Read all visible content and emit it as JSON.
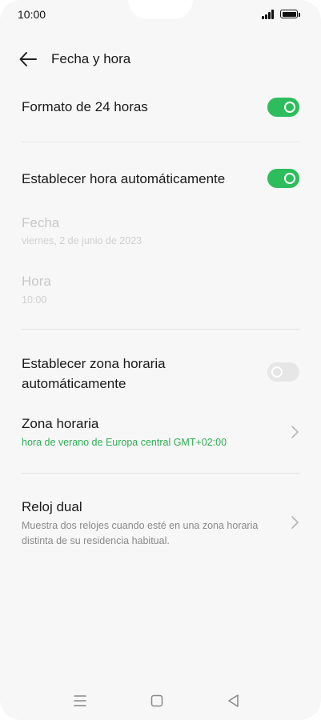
{
  "status_bar": {
    "time": "10:00"
  },
  "header": {
    "title": "Fecha y hora"
  },
  "settings": {
    "format_24h": {
      "label": "Formato de 24 horas",
      "enabled": true
    },
    "auto_time": {
      "label": "Establecer hora automáticamente",
      "enabled": true
    },
    "date": {
      "label": "Fecha",
      "value": "viernes, 2 de junio de 2023"
    },
    "time": {
      "label": "Hora",
      "value": "10:00"
    },
    "auto_timezone": {
      "label_line1": "Establecer zona horaria",
      "label_line2": "automáticamente",
      "enabled": false
    },
    "timezone": {
      "label": "Zona horaria",
      "value": "hora de verano de Europa central GMT+02:00"
    },
    "dual_clock": {
      "label": "Reloj dual",
      "desc_line1": "Muestra dos relojes cuando esté en una zona horaria",
      "desc_line2": "distinta de su residencia habitual."
    }
  },
  "colors": {
    "accent_green": "#2dbd5c",
    "subtitle_green": "#2dad53"
  },
  "icons": [
    "back-arrow-icon",
    "chevron-right-icon",
    "signal-icon",
    "battery-icon",
    "menu-nav-icon",
    "home-nav-icon",
    "back-nav-icon"
  ]
}
